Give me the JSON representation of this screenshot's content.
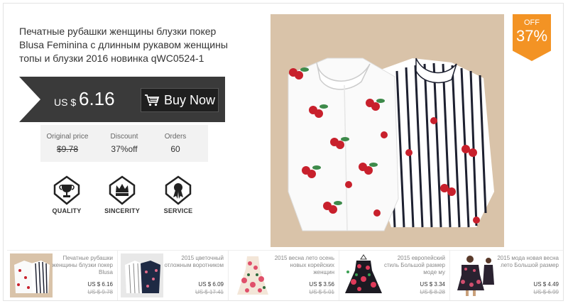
{
  "product": {
    "title": "Печатные рубашки женщины блузки покер Blusa Feminina с длинным рукавом женщины топы и блузки 2016 новинка qWC0524-1",
    "currency_label": "US $",
    "price": "6.16",
    "buy_label": "Buy Now"
  },
  "stats": {
    "original_label": "Original price",
    "original_value": "$9.78",
    "discount_label": "Discount",
    "discount_value": "37%off",
    "orders_label": "Orders",
    "orders_value": "60"
  },
  "badges": [
    {
      "label": "QUALITY",
      "icon": "trophy-icon"
    },
    {
      "label": "SINCERITY",
      "icon": "crown-icon"
    },
    {
      "label": "SERVICE",
      "icon": "ribbon-icon"
    }
  ],
  "discount_tag": {
    "off": "OFF",
    "percent": "37%"
  },
  "recommendations": [
    {
      "title": "Печатные рубашки женщины блузки покер Blusa",
      "price": "US $ 6.16",
      "old_price": "US $ 9.78"
    },
    {
      "title": "2015 цветочный отложным воротником",
      "price": "US $ 6.09",
      "old_price": "US $ 17.41"
    },
    {
      "title": "2015 весна лето осень новых корейских женщин",
      "price": "US $ 3.56",
      "old_price": "US $ 5.01"
    },
    {
      "title": "2015 европейский стиль Большой размер моде му",
      "price": "US $ 3.34",
      "old_price": "US $ 8.28"
    },
    {
      "title": "2015 мода новая весна лето Большой размер",
      "price": "US $ 4.49",
      "old_price": "US $ 6.99"
    }
  ],
  "colors": {
    "accent": "#f39324",
    "banner": "#3a3a3a",
    "stats_bg": "#f2f2f2"
  }
}
